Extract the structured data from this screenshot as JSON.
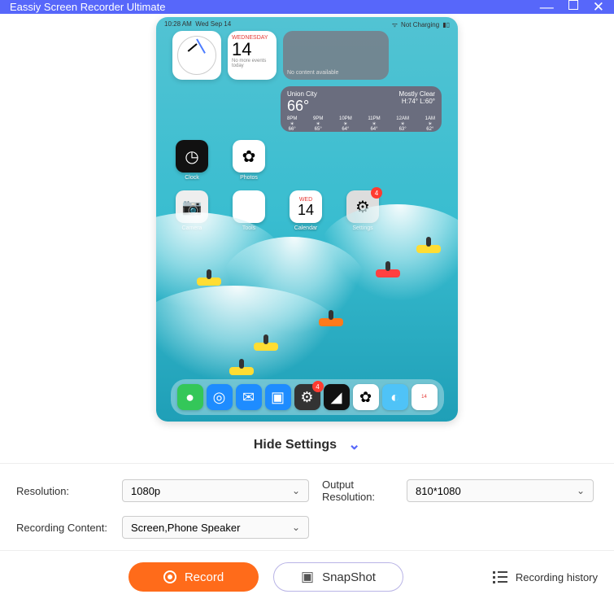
{
  "window": {
    "title": "Eassiy Screen Recorder Ultimate"
  },
  "device": {
    "status_time": "10:28 AM",
    "status_date": "Wed Sep 14",
    "status_right": "Not Charging",
    "calendar_widget": {
      "weekday": "WEDNESDAY",
      "day": "14",
      "note": "No more events today"
    },
    "blank_widget": "No content available",
    "weather": {
      "city": "Union City",
      "temp": "66°",
      "cond": "Mostly Clear",
      "hilo": "H:74° L:60°",
      "hours": [
        "8PM",
        "9PM",
        "10PM",
        "11PM",
        "12AM",
        "1AM"
      ],
      "temps": [
        "66°",
        "65°",
        "64°",
        "64°",
        "63°",
        "62°"
      ]
    },
    "apps_row1": [
      {
        "name": "Clock"
      },
      {
        "name": "Photos"
      }
    ],
    "apps_row2": [
      {
        "name": "Camera"
      },
      {
        "name": "Tools"
      },
      {
        "name": "Calendar",
        "weekday": "WED",
        "day": "14"
      },
      {
        "name": "Settings",
        "badge": "4"
      }
    ],
    "dock_badge": "4"
  },
  "toggle": {
    "label": "Hide Settings"
  },
  "settings": {
    "resolution_label": "Resolution:",
    "resolution_value": "1080p",
    "output_label": "Output Resolution:",
    "output_value": "810*1080",
    "content_label": "Recording Content:",
    "content_value": "Screen,Phone Speaker"
  },
  "buttons": {
    "record": "Record",
    "snapshot": "SnapShot",
    "history": "Recording history"
  }
}
